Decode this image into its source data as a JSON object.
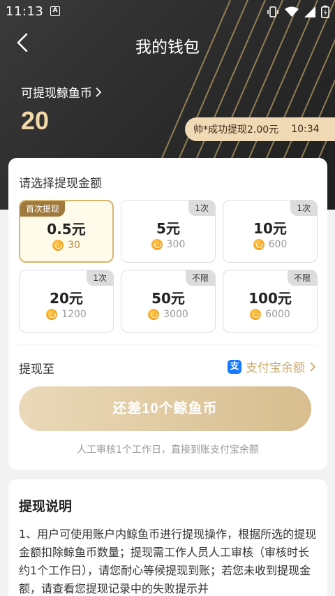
{
  "status_bar": {
    "time": "11:13",
    "app_icon": "A"
  },
  "nav": {
    "title": "我的钱包"
  },
  "withdrawable": {
    "label": "可提现鲸鱼币",
    "balance": "20"
  },
  "ticker": {
    "text": "帅*成功提现2.00元",
    "time": "10:34"
  },
  "select": {
    "title": "请选择提现金额",
    "options": [
      {
        "badge": "首次提现",
        "amount": "0.5元",
        "coins": "30",
        "selected": true
      },
      {
        "badge": "1次",
        "amount": "5元",
        "coins": "300"
      },
      {
        "badge": "1次",
        "amount": "10元",
        "coins": "600"
      },
      {
        "badge": "1次",
        "amount": "20元",
        "coins": "1200"
      },
      {
        "badge": "不限",
        "amount": "50元",
        "coins": "3000"
      },
      {
        "badge": "不限",
        "amount": "100元",
        "coins": "6000"
      }
    ]
  },
  "withdraw_to": {
    "label": "提现至",
    "method": "支付宝余额",
    "icon_char": "支"
  },
  "cta": {
    "label": "还差10个鲸鱼币"
  },
  "note": "人工审核1个工作日，直接到账支付宝余额",
  "info": {
    "title": "提现说明",
    "body": "1、用户可使用账户内鲸鱼币进行提现操作，根据所选的提现金额扣除鲸鱼币数量；提现需工作人员人工审核（审核时长约1个工作日），请您耐心等候提现到账；若您未收到提现金额，请查看您提现记录中的失败提示并"
  },
  "colors": {
    "header_bg": "#2a2a2a",
    "gold": "#f3d9a9",
    "accent": "#c9a86a",
    "cta_start": "#ead9b9",
    "cta_end": "#d7bd8e",
    "alipay": "#1677ff"
  }
}
